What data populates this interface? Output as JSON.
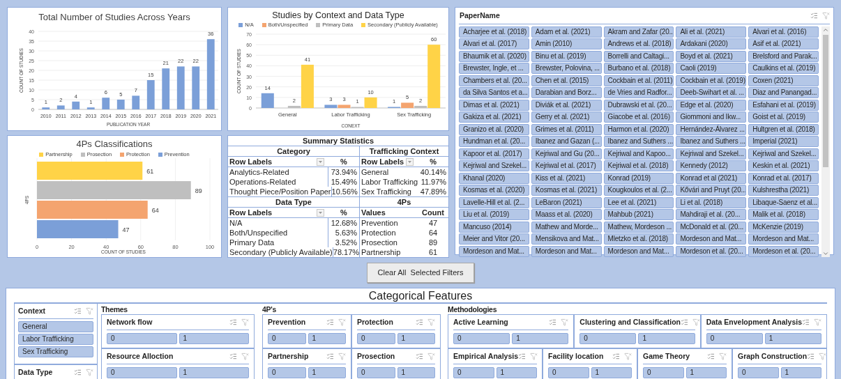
{
  "year_chart": {
    "title": "Total Number of Studies Across Years",
    "chart_data": {
      "type": "bar",
      "xlabel": "PUBLICATION YEAR",
      "ylabel": "COUNT OF STUDIES",
      "categories": [
        "2010",
        "2011",
        "2012",
        "2013",
        "2014",
        "2015",
        "2016",
        "2017",
        "2018",
        "2019",
        "2020",
        "2021"
      ],
      "series": [
        {
          "color": "#7b9fd8",
          "values": [
            1,
            2,
            4,
            1,
            6,
            5,
            7,
            15,
            21,
            22,
            22,
            36
          ]
        }
      ],
      "ylim": [
        0,
        40
      ],
      "yticks": [
        0,
        5,
        10,
        15,
        20,
        25,
        30,
        35,
        40
      ],
      "grid": true,
      "data_labels": true
    }
  },
  "ps_chart": {
    "title": "4Ps Classifications",
    "chart_data": {
      "type": "bar",
      "orientation": "horizontal",
      "stacked": false,
      "xlabel": "COUNT OF STUDIES",
      "ylabel": "4PS",
      "series": [
        {
          "name": "Partnership",
          "color": "#ffd347",
          "values": [
            61
          ]
        },
        {
          "name": "Prosection",
          "color": "#bfbfbf",
          "values": [
            89
          ]
        },
        {
          "name": "Protection",
          "color": "#f4a46f",
          "values": [
            64
          ]
        },
        {
          "name": "Prevention",
          "color": "#7b9fd8",
          "values": [
            47
          ]
        }
      ],
      "xlim": [
        0,
        100
      ],
      "xticks": [
        0,
        20,
        40,
        60,
        80,
        100
      ],
      "grid": true,
      "data_labels": true
    }
  },
  "context_chart": {
    "title": "Studies by Context and Data Type",
    "chart_data": {
      "type": "bar",
      "xlabel": "CONEXT",
      "ylabel": "COUNT OF STUDIES",
      "categories": [
        "General",
        "Labor Trafficking",
        "Sex Trafficking"
      ],
      "series": [
        {
          "name": "N/A",
          "color": "#7b9fd8",
          "values": [
            14,
            3,
            1
          ]
        },
        {
          "name": "Both/Unspecified",
          "color": "#f4a46f",
          "values": [
            null,
            3,
            5
          ]
        },
        {
          "name": "Primary Data",
          "color": "#bfbfbf",
          "values": [
            2,
            1,
            2
          ]
        },
        {
          "name": "Secondary (Publicly Available)",
          "color": "#ffd347",
          "values": [
            41,
            10,
            60
          ]
        }
      ],
      "ylim": [
        0,
        70
      ],
      "yticks": [
        0,
        10,
        20,
        30,
        40,
        50,
        60,
        70
      ],
      "grid": true,
      "data_labels": true
    }
  },
  "summary": {
    "title": "Summary Statistics",
    "category": {
      "title": "Category",
      "header": [
        "Row Labels",
        "%"
      ],
      "rows": [
        [
          "Analytics-Related",
          "73.94%"
        ],
        [
          "Operations-Related",
          "15.49%"
        ],
        [
          "Thought Piece/Position Paper",
          "10.56%"
        ]
      ]
    },
    "context": {
      "title": "Trafficking Context",
      "header": [
        "Row Labels",
        "%"
      ],
      "rows": [
        [
          "General",
          "40.14%"
        ],
        [
          "Labor Trafficking",
          "11.97%"
        ],
        [
          "Sex Trafficking",
          "47.89%"
        ]
      ]
    },
    "data_type": {
      "title": "Data Type",
      "header": [
        "Row Labels",
        "%"
      ],
      "rows": [
        [
          "N/A",
          "12.68%"
        ],
        [
          "Both/Unspecified",
          "5.63%"
        ],
        [
          "Primary Data",
          "3.52%"
        ],
        [
          "Secondary (Publicly Available)",
          "78.17%"
        ]
      ]
    },
    "four_ps": {
      "title": "4Ps",
      "header": [
        "Values",
        "Count"
      ],
      "rows": [
        [
          "Prevention",
          "47"
        ],
        [
          "Protection",
          "64"
        ],
        [
          "Prosection",
          "89"
        ],
        [
          "Partnership",
          "61"
        ]
      ]
    }
  },
  "papers": {
    "title": "PaperName",
    "items": [
      {
        "label": "Acharjee et al. (2018)",
        "selected": true
      },
      {
        "label": "Adam et al. (2021)",
        "selected": true
      },
      {
        "label": "Akram and Zafar (20...",
        "selected": true
      },
      {
        "label": "Ali et al. (2021)",
        "selected": true
      },
      {
        "label": "Alvari et al. (2016)",
        "selected": true
      },
      {
        "label": "Alvari et al. (2017)",
        "selected": true
      },
      {
        "label": "Amin (2010)",
        "selected": true
      },
      {
        "label": "Andrews et al. (2018)",
        "selected": true
      },
      {
        "label": "Ardakani (2020)",
        "selected": true
      },
      {
        "label": "Asif et al. (2021)",
        "selected": true
      },
      {
        "label": "Bhaumik et al. (2020)",
        "selected": true
      },
      {
        "label": "Binu et al. (2019)",
        "selected": true
      },
      {
        "label": "Borrelli and Caltagi...",
        "selected": true
      },
      {
        "label": "Boyd et al. (2021)",
        "selected": true
      },
      {
        "label": "Brelsford and Parak...",
        "selected": true
      },
      {
        "label": "Brewster, Ingle, et ...",
        "selected": true
      },
      {
        "label": "Brewster, Polovina, ...",
        "selected": true
      },
      {
        "label": "Burbano et al. (2018)",
        "selected": true
      },
      {
        "label": "Caoli (2019)",
        "selected": true
      },
      {
        "label": "Caulkins et al. (2019)",
        "selected": true
      },
      {
        "label": "Chambers et al. (20...",
        "selected": true
      },
      {
        "label": "Chen et al. (2015)",
        "selected": true
      },
      {
        "label": "Cockbain et al. (2011)",
        "selected": true
      },
      {
        "label": "Cockbain et al. (2019)",
        "selected": true
      },
      {
        "label": "Coxen (2021)",
        "selected": true
      },
      {
        "label": "da Silva Santos et a...",
        "selected": true
      },
      {
        "label": "Darabian and Borz...",
        "selected": true
      },
      {
        "label": "de Vries and Radfor...",
        "selected": true
      },
      {
        "label": "Deeb-Swihart et al. ...",
        "selected": true
      },
      {
        "label": "Diaz and Panangad...",
        "selected": true
      },
      {
        "label": "Dimas et al. (2021)",
        "selected": true
      },
      {
        "label": "Diviák et al. (2021)",
        "selected": true
      },
      {
        "label": "Dubrawski et al. (20...",
        "selected": true
      },
      {
        "label": "Edge et al. (2020)",
        "selected": true
      },
      {
        "label": "Esfahani et al. (2019)",
        "selected": true
      },
      {
        "label": "Gakiza et al. (2021)",
        "selected": true
      },
      {
        "label": "Gerry et al. (2021)",
        "selected": true
      },
      {
        "label": "Giacobe et al. (2016)",
        "selected": true
      },
      {
        "label": "Giommoni and Ikw...",
        "selected": true
      },
      {
        "label": "Goist et al. (2019)",
        "selected": true
      },
      {
        "label": "Granizo et al. (2020)",
        "selected": true
      },
      {
        "label": "Grimes et al. (2011)",
        "selected": true
      },
      {
        "label": "Harmon et al. (2020)",
        "selected": true
      },
      {
        "label": "Hernández-Álvarez ...",
        "selected": true
      },
      {
        "label": "Hultgren et al. (2018)",
        "selected": true
      },
      {
        "label": "Hundman et al. (20...",
        "selected": true
      },
      {
        "label": "Ibanez and Gazan (...",
        "selected": true
      },
      {
        "label": "Ibanez and Suthers ...",
        "selected": true
      },
      {
        "label": "Ibanez and Suthers ...",
        "selected": true
      },
      {
        "label": "Imperial (2021)",
        "selected": true
      },
      {
        "label": "Kapoor et al. (2017)",
        "selected": true
      },
      {
        "label": "Kejriwal and Gu (20...",
        "selected": true
      },
      {
        "label": "Kejriwal and Kapoo...",
        "selected": true
      },
      {
        "label": "Kejriwal and Szekel...",
        "selected": true
      },
      {
        "label": "Kejriwal and Szekel...",
        "selected": true
      },
      {
        "label": "Kejriwal and Szekel...",
        "selected": true
      },
      {
        "label": "Kejriwal et al. (2017)",
        "selected": true
      },
      {
        "label": "Kejriwal et al. (2018)",
        "selected": true
      },
      {
        "label": "Kennedy (2012)",
        "selected": true
      },
      {
        "label": "Keskin et al. (2021)",
        "selected": true
      },
      {
        "label": "Khanal (2020)",
        "selected": true
      },
      {
        "label": "Kiss et al. (2021)",
        "selected": true
      },
      {
        "label": "Konrad (2019)",
        "selected": true
      },
      {
        "label": "Konrad et al (2021)",
        "selected": true
      },
      {
        "label": "Konrad et al. (2017)",
        "selected": true
      },
      {
        "label": "Kosmas et al. (2020)",
        "selected": true
      },
      {
        "label": "Kosmas et al. (2021)",
        "selected": true
      },
      {
        "label": "Kougkoulos et al. (2...",
        "selected": true
      },
      {
        "label": "Kővári and Pruyt (20...",
        "selected": true
      },
      {
        "label": "Kulshrestha (2021)",
        "selected": true
      },
      {
        "label": "Lavelle-Hill et al. (2...",
        "selected": true
      },
      {
        "label": "LeBaron (2021)",
        "selected": true
      },
      {
        "label": "Lee et al. (2021)",
        "selected": true
      },
      {
        "label": "Li et al. (2018)",
        "selected": true
      },
      {
        "label": "Libaque-Saenz et al...",
        "selected": true
      },
      {
        "label": "Liu et al. (2019)",
        "selected": true
      },
      {
        "label": "Maass et al. (2020)",
        "selected": true
      },
      {
        "label": "Mahbub (2021)",
        "selected": true
      },
      {
        "label": "Mahdiraji et al. (20...",
        "selected": true
      },
      {
        "label": "Malik et al. (2018)",
        "selected": true
      },
      {
        "label": "Mancuso (2014)",
        "selected": true
      },
      {
        "label": "Mathew and Morde...",
        "selected": true
      },
      {
        "label": "Mathew, Mordeson ...",
        "selected": true
      },
      {
        "label": "McDonald et al. (20...",
        "selected": true
      },
      {
        "label": "McKenzie (2019)",
        "selected": true
      },
      {
        "label": "Meier and Vitor (20...",
        "selected": true
      },
      {
        "label": "Mensikova and Mat...",
        "selected": true
      },
      {
        "label": "Mletzko et al. (2018)",
        "selected": true
      },
      {
        "label": "Mordeson and Mat...",
        "selected": true
      },
      {
        "label": "Mordeson and Mat...",
        "selected": true
      },
      {
        "label": "Mordeson and Mat...",
        "selected": true
      },
      {
        "label": "Mordeson and Mat...",
        "selected": true
      },
      {
        "label": "Mordeson and Mat...",
        "selected": true
      },
      {
        "label": "Mordeson et al. (20...",
        "selected": true
      },
      {
        "label": "Mordeson et al. (20...",
        "selected": true
      }
    ]
  },
  "clear_button": "Clear All  Selected Filters",
  "categorical": {
    "title": "Categorical Features",
    "context": {
      "title": "Context",
      "items": [
        {
          "label": "General",
          "selected": true
        },
        {
          "label": "Labor Trafficking",
          "selected": true
        },
        {
          "label": "Sex Trafficking",
          "selected": true
        }
      ]
    },
    "data_type": {
      "title": "Data Type"
    },
    "groups": [
      {
        "title": "Themes",
        "shelves": [
          {
            "slicers": [
              {
                "title": "Network flow",
                "items": [
                  {
                    "label": "0",
                    "selected": true
                  },
                  {
                    "label": "1",
                    "selected": true
                  }
                ]
              }
            ]
          },
          {
            "slicers": [
              {
                "title": "Resource Alloction",
                "items": [
                  {
                    "label": "0",
                    "selected": true
                  },
                  {
                    "label": "1",
                    "selected": true
                  }
                ]
              }
            ]
          }
        ]
      },
      {
        "title": "4P's",
        "shelves": [
          {
            "slicers": [
              {
                "title": "Prevention",
                "items": [
                  {
                    "label": "0",
                    "selected": true
                  },
                  {
                    "label": "1",
                    "selected": true
                  }
                ]
              },
              {
                "title": "Protection",
                "items": [
                  {
                    "label": "0",
                    "selected": true
                  },
                  {
                    "label": "1",
                    "selected": true
                  }
                ]
              }
            ]
          },
          {
            "slicers": [
              {
                "title": "Partnership",
                "items": [
                  {
                    "label": "0",
                    "selected": true
                  },
                  {
                    "label": "1",
                    "selected": true
                  }
                ]
              },
              {
                "title": "Prosection",
                "items": [
                  {
                    "label": "0",
                    "selected": true
                  },
                  {
                    "label": "1",
                    "selected": true
                  }
                ]
              }
            ]
          }
        ]
      },
      {
        "title": "Methodologies",
        "shelves": [
          {
            "slicers": [
              {
                "title": "Active Learning",
                "items": [
                  {
                    "label": "0",
                    "selected": true
                  },
                  {
                    "label": "1",
                    "selected": true
                  }
                ]
              },
              {
                "title": "Clustering and Classification",
                "items": [
                  {
                    "label": "0",
                    "selected": true
                  },
                  {
                    "label": "1",
                    "selected": true
                  }
                ]
              },
              {
                "title": "Data Envelopment Analysis",
                "items": [
                  {
                    "label": "0",
                    "selected": true
                  },
                  {
                    "label": "1",
                    "selected": true
                  }
                ]
              }
            ]
          },
          {
            "slicers": [
              {
                "title": "Empirical Analysis",
                "items": [
                  {
                    "label": "0",
                    "selected": true
                  },
                  {
                    "label": "1",
                    "selected": true
                  }
                ]
              },
              {
                "title": "Facility location",
                "items": [
                  {
                    "label": "0",
                    "selected": true
                  },
                  {
                    "label": "1",
                    "selected": true
                  }
                ]
              },
              {
                "title": "Game Theory",
                "items": [
                  {
                    "label": "0",
                    "selected": true
                  },
                  {
                    "label": "1",
                    "selected": true
                  }
                ]
              },
              {
                "title": "Graph Construction",
                "items": [
                  {
                    "label": "0",
                    "selected": true
                  },
                  {
                    "label": "1",
                    "selected": true
                  }
                ]
              }
            ]
          }
        ]
      }
    ]
  }
}
